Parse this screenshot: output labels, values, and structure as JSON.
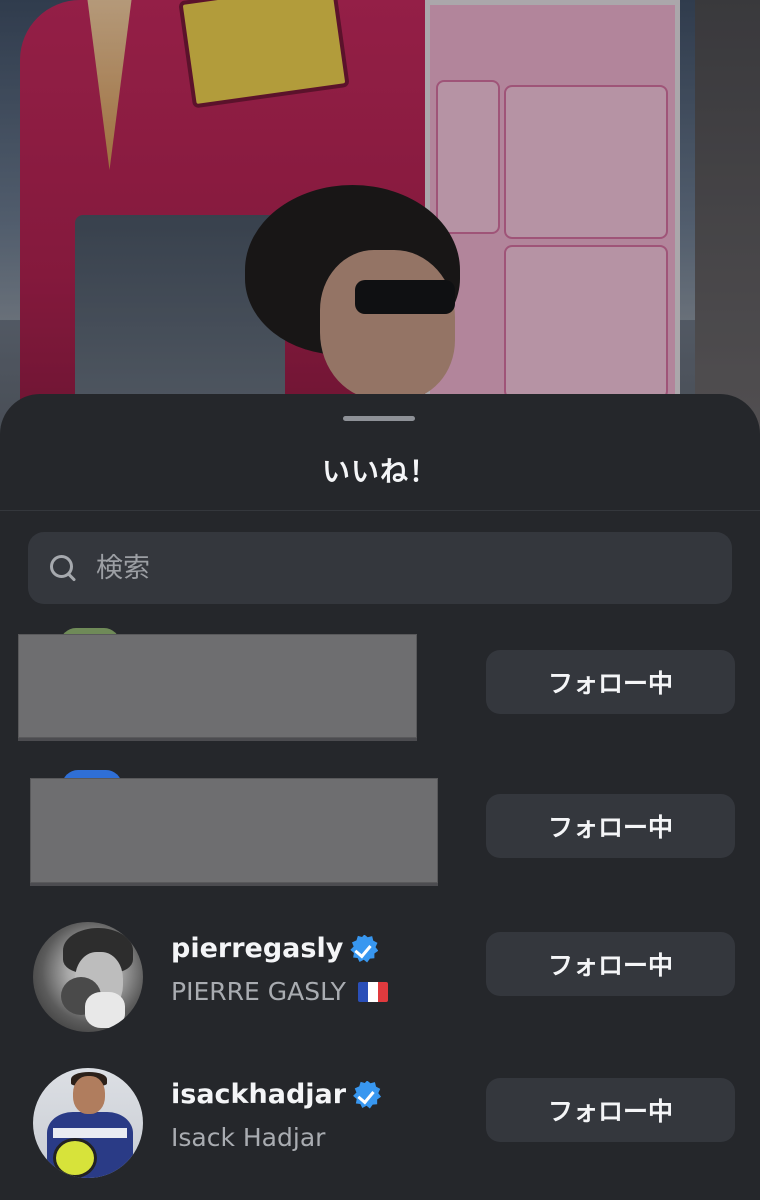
{
  "sheet": {
    "title": "いいね！"
  },
  "search": {
    "placeholder": "検索"
  },
  "users": [
    {
      "redacted": true,
      "follow_label": "フォロー中"
    },
    {
      "redacted": true,
      "follow_label": "フォロー中"
    },
    {
      "username": "pierregasly",
      "verified": true,
      "full_name": "PIERRE GASLY",
      "flag": "🇫🇷",
      "follow_label": "フォロー中"
    },
    {
      "username": "isackhadjar",
      "verified": true,
      "full_name": "Isack Hadjar",
      "follow_label": "フォロー中"
    }
  ],
  "colors": {
    "sheet_bg": "#25272b",
    "button_bg": "#34373d",
    "verified_blue": "#3897f0",
    "secondary_text": "#a9acb1"
  },
  "icons": [
    "search-icon",
    "verified-badge-icon",
    "france-flag-icon"
  ]
}
